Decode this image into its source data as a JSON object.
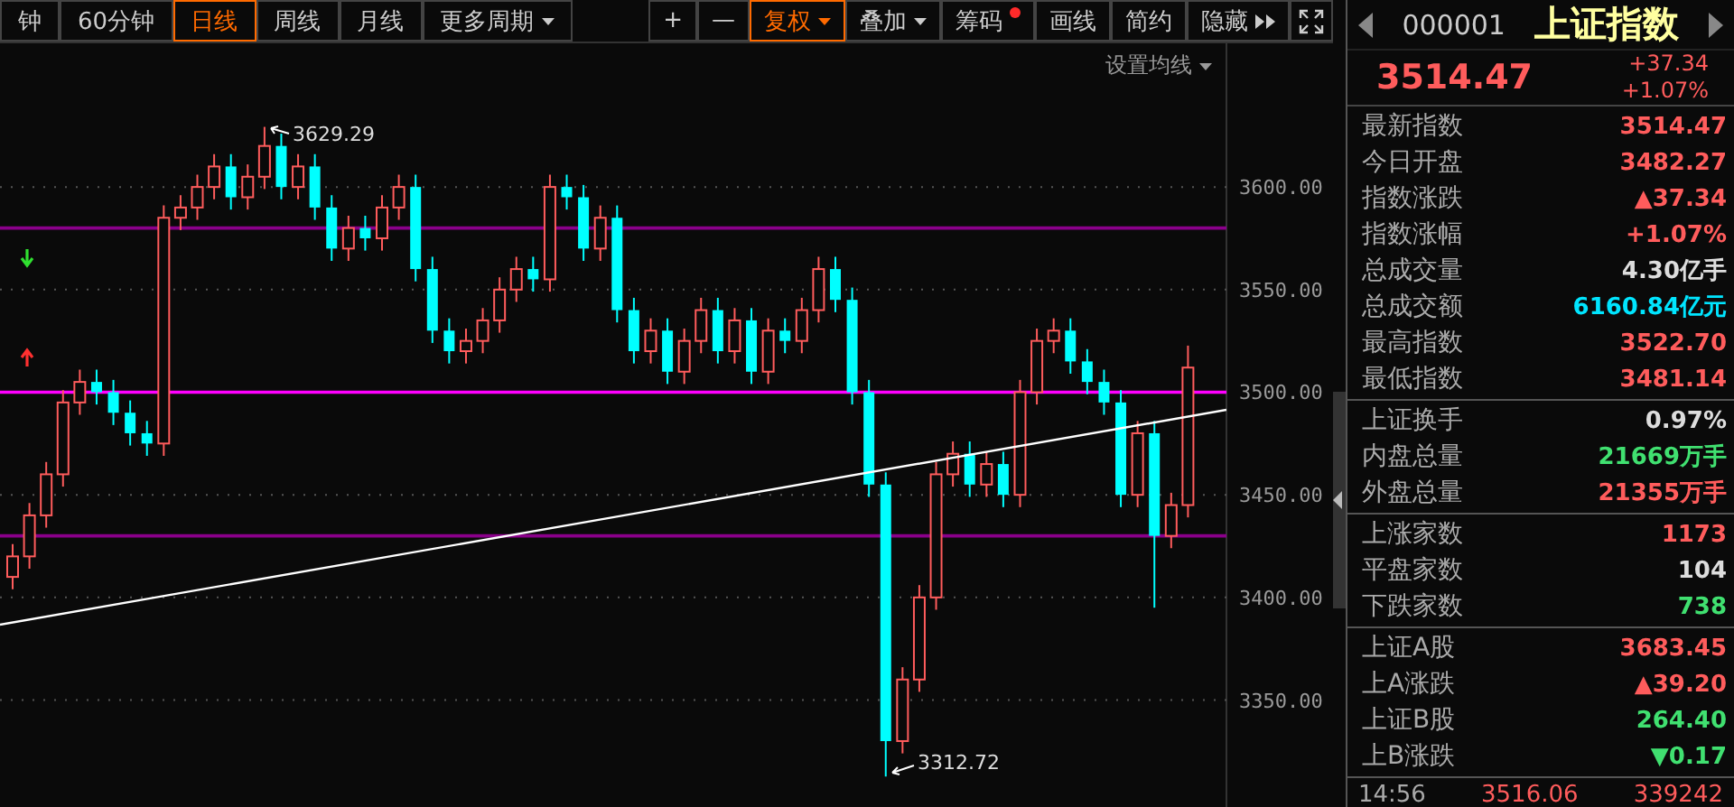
{
  "toolbar": {
    "periods": [
      {
        "label": "钟",
        "selected": false,
        "caret": false
      },
      {
        "label": "60分钟",
        "selected": false,
        "caret": false
      },
      {
        "label": "日线",
        "selected": true,
        "caret": false
      },
      {
        "label": "周线",
        "selected": false,
        "caret": false
      },
      {
        "label": "月线",
        "selected": false,
        "caret": false
      },
      {
        "label": "更多周期",
        "selected": false,
        "caret": true
      }
    ],
    "tools": [
      {
        "label": "+",
        "selected": false,
        "caret": false,
        "badge_dot": false
      },
      {
        "label": "—",
        "selected": false,
        "caret": false,
        "badge_dot": false
      },
      {
        "label": "复权",
        "selected": true,
        "caret": true,
        "badge_dot": false
      },
      {
        "label": "叠加",
        "selected": false,
        "caret": true,
        "badge_dot": false
      },
      {
        "label": "筹码",
        "selected": false,
        "caret": false,
        "badge_dot": true
      },
      {
        "label": "画线",
        "selected": false,
        "caret": false,
        "badge_dot": false
      },
      {
        "label": "简约",
        "selected": false,
        "caret": false,
        "badge_dot": false
      },
      {
        "label": "隐藏",
        "selected": false,
        "caret": false,
        "badge_dot": false
      }
    ]
  },
  "chart": {
    "ma_setting": "设置均线",
    "high_label": "3629.29",
    "low_label": "3312.72",
    "chart_data": {
      "type": "candlestick",
      "grid": true,
      "ylim": [
        3297,
        3670
      ],
      "ref_lines": [
        {
          "axis": "y",
          "value": 3580,
          "color": "#8a008a"
        },
        {
          "axis": "y",
          "value": 3500,
          "color": "#ff00ff"
        },
        {
          "axis": "y",
          "value": 3430,
          "color": "#8a008a"
        }
      ],
      "ohlc": [
        [
          3410,
          3426,
          3404,
          3420
        ],
        [
          3420,
          3446,
          3414,
          3440
        ],
        [
          3440,
          3466,
          3434,
          3460
        ],
        [
          3460,
          3501,
          3454,
          3495
        ],
        [
          3495,
          3511,
          3489,
          3505
        ],
        [
          3505,
          3511,
          3494,
          3500
        ],
        [
          3500,
          3506,
          3484,
          3490
        ],
        [
          3490,
          3496,
          3474,
          3480
        ],
        [
          3480,
          3486,
          3469,
          3475
        ],
        [
          3475,
          3591,
          3469,
          3585
        ],
        [
          3585,
          3596,
          3579,
          3590
        ],
        [
          3590,
          3606,
          3584,
          3600
        ],
        [
          3600,
          3616,
          3594,
          3610
        ],
        [
          3610,
          3616,
          3589,
          3595
        ],
        [
          3595,
          3611,
          3589,
          3605
        ],
        [
          3605,
          3629.29,
          3599,
          3620
        ],
        [
          3620,
          3626,
          3594,
          3600
        ],
        [
          3600,
          3616,
          3594,
          3610
        ],
        [
          3610,
          3616,
          3584,
          3590
        ],
        [
          3590,
          3596,
          3564,
          3570
        ],
        [
          3570,
          3586,
          3564,
          3580
        ],
        [
          3580,
          3586,
          3569,
          3575
        ],
        [
          3575,
          3596,
          3569,
          3590
        ],
        [
          3590,
          3606,
          3584,
          3600
        ],
        [
          3600,
          3606,
          3554,
          3560
        ],
        [
          3560,
          3566,
          3524,
          3530
        ],
        [
          3530,
          3536,
          3514,
          3520
        ],
        [
          3520,
          3531,
          3514,
          3525
        ],
        [
          3525,
          3541,
          3519,
          3535
        ],
        [
          3535,
          3556,
          3529,
          3550
        ],
        [
          3550,
          3566,
          3544,
          3560
        ],
        [
          3560,
          3566,
          3549,
          3555
        ],
        [
          3555,
          3606,
          3549,
          3600
        ],
        [
          3600,
          3606,
          3589,
          3595
        ],
        [
          3595,
          3601,
          3564,
          3570
        ],
        [
          3570,
          3591,
          3564,
          3585
        ],
        [
          3585,
          3591,
          3534,
          3540
        ],
        [
          3540,
          3546,
          3514,
          3520
        ],
        [
          3520,
          3536,
          3514,
          3530
        ],
        [
          3530,
          3536,
          3504,
          3510
        ],
        [
          3510,
          3531,
          3504,
          3525
        ],
        [
          3525,
          3546,
          3519,
          3540
        ],
        [
          3540,
          3546,
          3514,
          3520
        ],
        [
          3520,
          3541,
          3514,
          3535
        ],
        [
          3535,
          3541,
          3504,
          3510
        ],
        [
          3510,
          3536,
          3504,
          3530
        ],
        [
          3530,
          3536,
          3519,
          3525
        ],
        [
          3525,
          3546,
          3519,
          3540
        ],
        [
          3540,
          3566,
          3534,
          3560
        ],
        [
          3560,
          3566,
          3539,
          3545
        ],
        [
          3545,
          3551,
          3494,
          3500
        ],
        [
          3500,
          3506,
          3449,
          3455
        ],
        [
          3455,
          3461,
          3312.72,
          3330
        ],
        [
          3330,
          3366,
          3324,
          3360
        ],
        [
          3360,
          3406,
          3354,
          3400
        ],
        [
          3400,
          3466,
          3394,
          3460
        ],
        [
          3460,
          3476,
          3454,
          3470
        ],
        [
          3470,
          3476,
          3449,
          3455
        ],
        [
          3455,
          3471,
          3449,
          3465
        ],
        [
          3465,
          3471,
          3444,
          3450
        ],
        [
          3450,
          3506,
          3444,
          3500
        ],
        [
          3500,
          3531,
          3494,
          3525
        ],
        [
          3525,
          3536,
          3519,
          3530
        ],
        [
          3530,
          3536,
          3509,
          3515
        ],
        [
          3515,
          3521,
          3499,
          3505
        ],
        [
          3505,
          3511,
          3489,
          3495
        ],
        [
          3495,
          3501,
          3444,
          3450
        ],
        [
          3450,
          3486,
          3444,
          3480
        ],
        [
          3480,
          3486,
          3395,
          3430
        ],
        [
          3430,
          3451,
          3424,
          3445
        ],
        [
          3445,
          3522.7,
          3439,
          3512
        ]
      ],
      "yticks": [
        {
          "value": 3600,
          "label": "3600.00"
        },
        {
          "value": 3550,
          "label": "3550.00"
        },
        {
          "value": 3500,
          "label": "3500.00"
        },
        {
          "value": 3450,
          "label": "3450.00"
        },
        {
          "value": 3400,
          "label": "3400.00"
        },
        {
          "value": 3350,
          "label": "3350.00"
        }
      ]
    }
  },
  "quote": {
    "code": "000001",
    "name": "上证指数",
    "price": "3514.47",
    "change": "+37.34",
    "change_pct": "+1.07%",
    "sections": [
      [
        {
          "label": "最新指数",
          "value": "3514.47",
          "color": "#ff5c5c"
        },
        {
          "label": "今日开盘",
          "value": "3482.27",
          "color": "#ff5c5c"
        },
        {
          "label": "指数涨跌",
          "value": "▲37.34",
          "color": "#ff5c5c"
        },
        {
          "label": "指数涨幅",
          "value": "+1.07%",
          "color": "#ff5c5c"
        },
        {
          "label": "总成交量",
          "value": "4.30亿手",
          "color": "#dddddd"
        },
        {
          "label": "总成交额",
          "value": "6160.84亿元",
          "color": "#00e5ff"
        },
        {
          "label": "最高指数",
          "value": "3522.70",
          "color": "#ff5c5c"
        },
        {
          "label": "最低指数",
          "value": "3481.14",
          "color": "#ff5c5c"
        }
      ],
      [
        {
          "label": "上证换手",
          "value": "0.97%",
          "color": "#dddddd"
        },
        {
          "label": "内盘总量",
          "value": "21669万手",
          "color": "#40e070"
        },
        {
          "label": "外盘总量",
          "value": "21355万手",
          "color": "#ff5c5c"
        }
      ],
      [
        {
          "label": "上涨家数",
          "value": "1173",
          "color": "#ff5c5c"
        },
        {
          "label": "平盘家数",
          "value": "104",
          "color": "#dddddd"
        },
        {
          "label": "下跌家数",
          "value": "738",
          "color": "#40e070"
        }
      ],
      [
        {
          "label": "上证A股",
          "value": "3683.45",
          "color": "#ff5c5c"
        },
        {
          "label": "上A涨跌",
          "value": "▲39.20",
          "color": "#ff5c5c"
        },
        {
          "label": "上证B股",
          "value": "264.40",
          "color": "#40e070"
        },
        {
          "label": "上B涨跌",
          "value": "▼0.17",
          "color": "#40e070"
        }
      ]
    ],
    "tick": {
      "time": "14:56",
      "price": "3516.06",
      "volume": "339242"
    }
  }
}
